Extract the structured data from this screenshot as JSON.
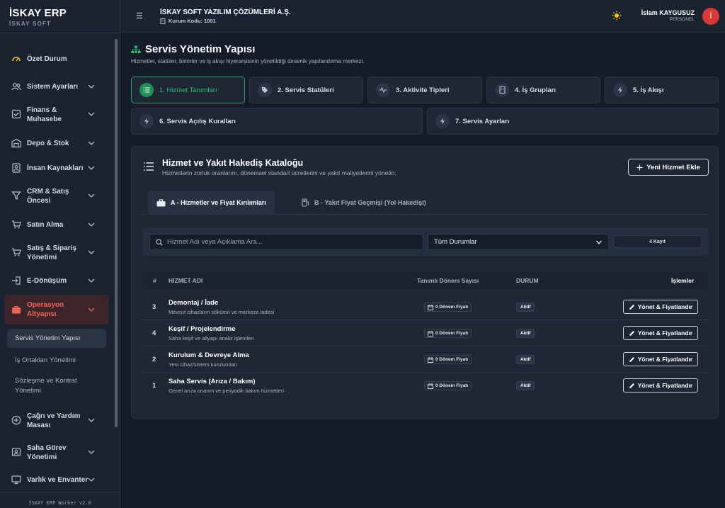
{
  "brand": {
    "title": "İSKAY ERP",
    "subtitle": "İSKAY SOFT"
  },
  "header": {
    "company": "İSKAY SOFT YAZILIM ÇÖZÜMLERİ A.Ş.",
    "company_code": "Kurum Kodu: 1001",
    "user_name": "İslam KAYGUSUZ",
    "user_role": "PERSONEL",
    "avatar_initial": "İ"
  },
  "sidebar": {
    "items": [
      {
        "label": "Özet Durum",
        "icon": "gauge-icon"
      },
      {
        "label": "Sistem Ayarları",
        "icon": "users-icon"
      },
      {
        "label": "Finans & Muhasebe",
        "icon": "checkbox-icon"
      },
      {
        "label": "Depo & Stok",
        "icon": "warehouse-icon"
      },
      {
        "label": "İnsan Kaynakları",
        "icon": "id-card-icon"
      },
      {
        "label": "CRM & Satış Öncesi",
        "icon": "funnel-icon"
      },
      {
        "label": "Satın Alma",
        "icon": "cart-icon"
      },
      {
        "label": "Satış & Sipariş Yönetimi",
        "icon": "cart-icon"
      },
      {
        "label": "E-Dönüşüm",
        "icon": "sign-in-icon"
      },
      {
        "label": "Operasyon Altyapısı",
        "icon": "briefcase-icon"
      },
      {
        "label": "Çağrı ve Yardım Masası",
        "icon": "plus-circle-icon"
      },
      {
        "label": "Saha Görev Yönetimi",
        "icon": "id-card-icon"
      },
      {
        "label": "Varlık ve Envanter",
        "icon": "monitor-icon"
      }
    ],
    "subitems": [
      "Servis Yönetim Yapısı",
      "İş Ortakları Yönetimi",
      "Sözleşme ve Kontrat Yönetimi"
    ],
    "footer": "İSKAY ERP Worker v2.0"
  },
  "page": {
    "title": "Servis Yönetim Yapısı",
    "description": "Hizmetler, statüler, birimler ve iş akışı hiyerarşisinin yönetildiği dinamik yapılandırma merkezi."
  },
  "steps": [
    {
      "label": "1. Hizmet Tanımları"
    },
    {
      "label": "2. Servis Statüleri"
    },
    {
      "label": "3. Aktivite Tipleri"
    },
    {
      "label": "4. İş Grupları"
    },
    {
      "label": "5. İş Akışı"
    },
    {
      "label": "6. Servis Açılış Kuralları"
    },
    {
      "label": "7. Servis Ayarları"
    }
  ],
  "card": {
    "title": "Hizmet ve Yakıt Hakediş Kataloğu",
    "subtitle": "Hizmetlerin zorluk oranlarını, dönemsel standart ücretlerini ve yakıt maliyetlerini yönetin.",
    "add_label": "Yeni Hizmet Ekle",
    "tabs": [
      "A - Hizmetler ve Fiyat Kırılımları",
      "B - Yakıt Fiyat Geçmişi (Yol Hakedişi)"
    ],
    "search_placeholder": "Hizmet Adı veya Açıklama Ara...",
    "status_select": "Tüm Durumlar",
    "count": "4 Kayıt",
    "columns": {
      "num": "#",
      "name": "HİZMET ADI",
      "periods": "Tanımlı Dönem Sayısı",
      "status": "DURUM",
      "actions": "İşlemler"
    },
    "rows": [
      {
        "num": "3",
        "name": "Demontaj / İade",
        "desc": "Mevcut cihazların sökümü ve merkeze iadesi",
        "periods": "0 Dönem Fiyatı",
        "status": "Aktif",
        "action": "Yönet & Fiyatlandır"
      },
      {
        "num": "4",
        "name": "Keşif / Projelendirme",
        "desc": "Saha keşif ve altyapı analiz işlemleri",
        "periods": "0 Dönem Fiyatı",
        "status": "Aktif",
        "action": "Yönet & Fiyatlandır"
      },
      {
        "num": "2",
        "name": "Kurulum & Devreye Alma",
        "desc": "Yeni cihaz/sistem kurulumları",
        "periods": "0 Dönem Fiyatı",
        "status": "Aktif",
        "action": "Yönet & Fiyatlandır"
      },
      {
        "num": "1",
        "name": "Saha Servis (Arıza / Bakım)",
        "desc": "Genel arıza onarım ve periyodik bakım hizmetleri",
        "periods": "0 Dönem Fiyatı",
        "status": "Aktif",
        "action": "Yönet & Fiyatlandır"
      }
    ]
  },
  "colors": {
    "accent_green": "#2fbf7e",
    "active_red": "#f0635f",
    "avatar_red": "#d83a3a",
    "sun_yellow": "#f5c518",
    "background": "#151c28"
  }
}
